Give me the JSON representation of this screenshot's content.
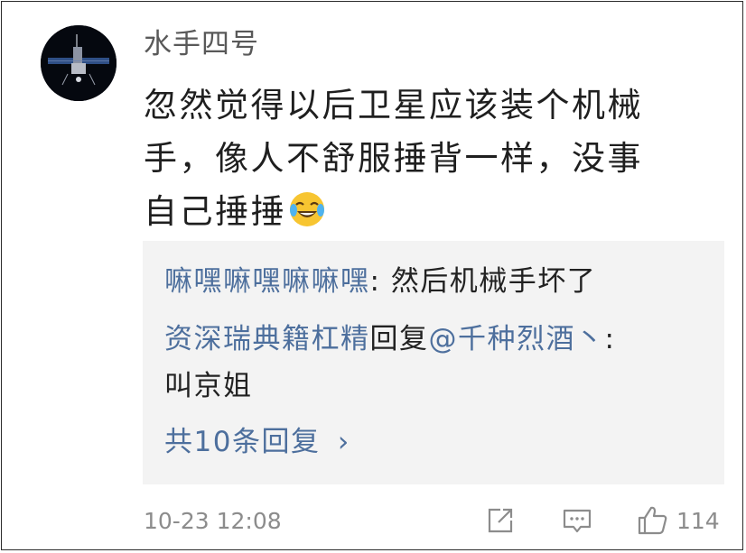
{
  "comment": {
    "username": "水手四号",
    "content_lines": [
      "忽然觉得以后卫星应该装个机械",
      "手，像人不舒服捶背一样，没事",
      "自己捶捶"
    ],
    "emoji": "crying-laughing-emoji",
    "timestamp": "10-23 12:08",
    "like_count": "114"
  },
  "replies": [
    {
      "author": "嘛嘿嘛嘿嘛嘛嘿",
      "separator": ": ",
      "text": "然后机械手坏了"
    },
    {
      "author": "资深瑞典籍杠精",
      "reply_word": "回复",
      "target": "@千种烈酒丶",
      "separator": ": ",
      "text": "叫京姐"
    }
  ],
  "more_replies": {
    "label": "共10条回复",
    "chevron": "›"
  },
  "icons": {
    "share": "share-icon",
    "comment": "comment-icon",
    "like": "thumbs-up-icon"
  },
  "colors": {
    "link": "#4d6f9d",
    "text": "#1f1f1f",
    "meta": "#8c8c8c",
    "reply_bg": "#f3f3f3"
  }
}
